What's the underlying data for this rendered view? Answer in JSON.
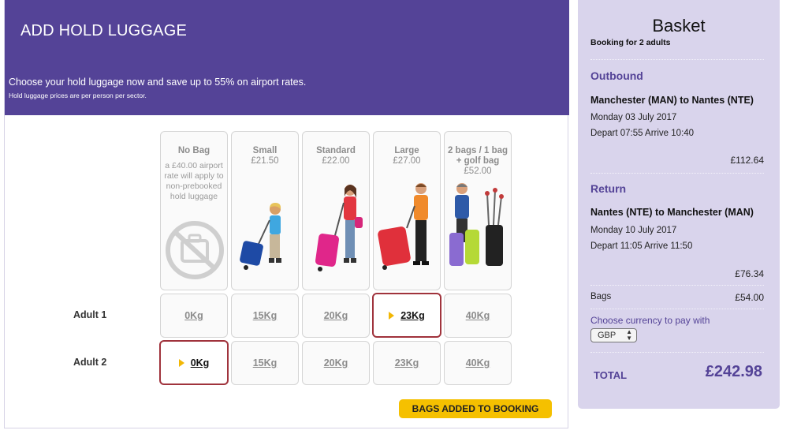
{
  "banner": {
    "title": "ADD HOLD LUGGAGE",
    "subtitle": "Choose your hold luggage now and save up to 55% on airport rates.",
    "note": "Hold luggage prices are per person per sector."
  },
  "options": [
    {
      "name": "No Bag",
      "price": "",
      "note": "a £40.00 airport rate will apply to non-prebooked hold luggage",
      "icon": "no-bag-icon"
    },
    {
      "name": "Small",
      "price": "£21.50",
      "note": "",
      "icon": "small-bag-traveller"
    },
    {
      "name": "Standard",
      "price": "£22.00",
      "note": "",
      "icon": "standard-bag-traveller"
    },
    {
      "name": "Large",
      "price": "£27.00",
      "note": "",
      "icon": "large-bag-traveller"
    },
    {
      "name": "2 bags / 1 bag + golf bag",
      "price": "£52.00",
      "note": "",
      "icon": "two-bags-golf-traveller"
    }
  ],
  "passengers": [
    {
      "label": "Adult 1",
      "weights": [
        "0Kg",
        "15Kg",
        "20Kg",
        "23Kg",
        "40Kg"
      ],
      "selected_index": 3
    },
    {
      "label": "Adult 2",
      "weights": [
        "0Kg",
        "15Kg",
        "20Kg",
        "23Kg",
        "40Kg"
      ],
      "selected_index": 0
    }
  ],
  "bags_button": "BAGS ADDED TO BOOKING",
  "basket": {
    "title": "Basket",
    "booking_for": "Booking for 2 adults",
    "outbound": {
      "heading": "Outbound",
      "route": "Manchester (MAN) to Nantes (NTE)",
      "date": "Monday 03 July 2017",
      "times": "Depart 07:55 Arrive 10:40",
      "price": "£112.64"
    },
    "return": {
      "heading": "Return",
      "route": "Nantes (NTE) to Manchester (MAN)",
      "date": "Monday 10 July 2017",
      "times": "Depart 11:05 Arrive 11:50",
      "price": "£76.34"
    },
    "bags_label": "Bags",
    "bags_price": "£54.00",
    "currency_label": "Choose currency to pay with",
    "currency_value": "GBP",
    "total_label": "TOTAL",
    "total_value": "£242.98"
  },
  "colors": {
    "brand_purple": "#544397",
    "basket_bg": "#d9d4ec",
    "selected_border": "#a0333c",
    "button_yellow": "#f5c000"
  }
}
